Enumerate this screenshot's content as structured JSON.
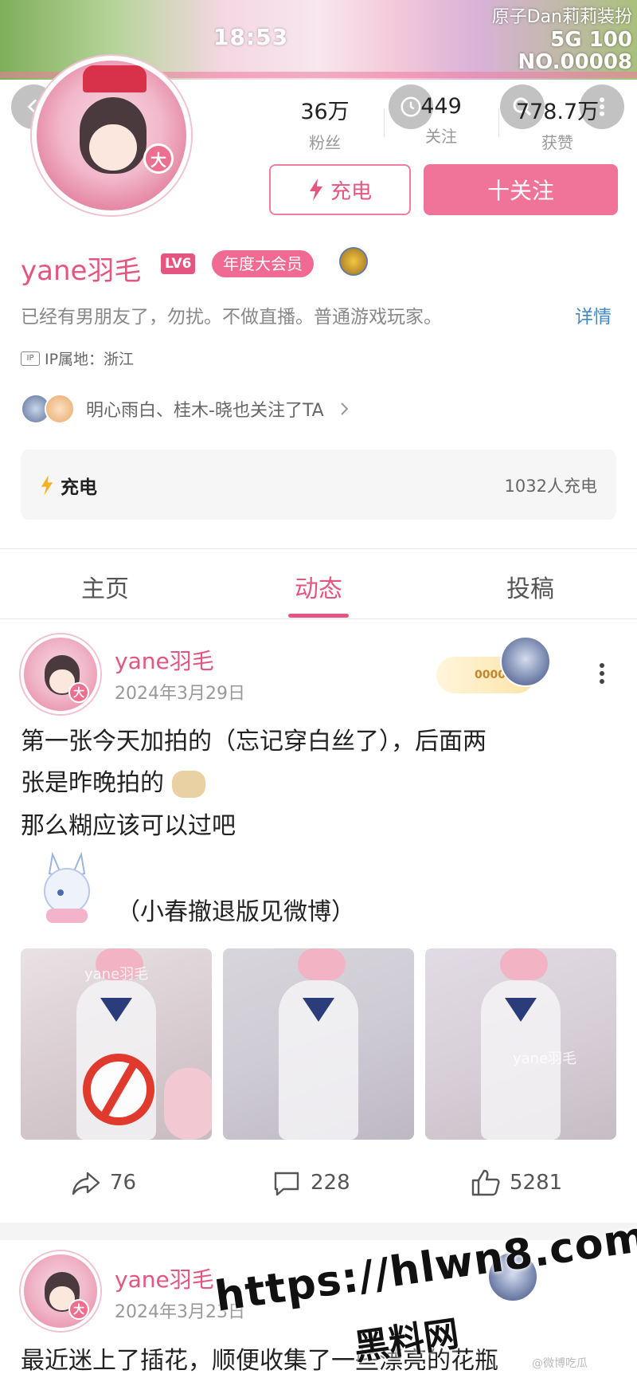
{
  "status_bar": {
    "time": "18:53",
    "top_right_text": "原子Dan莉莉装扮",
    "network": "5G",
    "battery": "100",
    "badge_no": "NO.00008"
  },
  "header": {
    "back_icon": "chevron-left-icon",
    "stats": [
      {
        "value": "36万",
        "label": "粉丝"
      },
      {
        "value": "449",
        "label": "关注"
      },
      {
        "value": "778.7万",
        "label": "获赞"
      }
    ],
    "charge_button": "充电",
    "follow_button": "十关注"
  },
  "profile": {
    "avatar_badge": "大",
    "username": "yane羽毛",
    "level": "LV6",
    "vip_badge": "年度大会员",
    "bio": "已经有男朋友了，勿扰。不做直播。普通游戏玩家。",
    "detail_link": "详情",
    "ip_tag": "IP",
    "ip_location": "IP属地：浙江",
    "mutual_follow": "明心雨白、桂木-晓也关注了TA",
    "charge_card": {
      "label": "充电",
      "count": "1032人充电"
    }
  },
  "tabs": [
    {
      "label": "主页",
      "active": false
    },
    {
      "label": "动态",
      "active": true
    },
    {
      "label": "投稿",
      "active": false
    }
  ],
  "posts": [
    {
      "author": "yane羽毛",
      "date": "2024年3月29日",
      "fan_badge_no": "000006",
      "text_line1": "第一张今天加拍的（忘记穿白丝了），后面两",
      "text_line2": "张是昨晚拍的",
      "text_line3": "那么糊应该可以过吧",
      "sticker_caption": "（小春撤退版见微博）",
      "image_watermark_1": "yane羽毛",
      "image_watermark_3": "yane羽毛",
      "shares": "76",
      "comments": "228",
      "likes": "5281"
    },
    {
      "author": "yane羽毛",
      "date": "2024年3月23日",
      "text_line1": "最近迷上了插花，顺便收集了一些漂亮的花瓶"
    }
  ],
  "overlay": {
    "url": "https://hlwn8.com",
    "site": "黑料网",
    "corner": "@微博吃瓜"
  },
  "colors": {
    "accent_pink": "#e4567f",
    "follow_bg": "#f0739a",
    "link_blue": "#3f88c8"
  }
}
